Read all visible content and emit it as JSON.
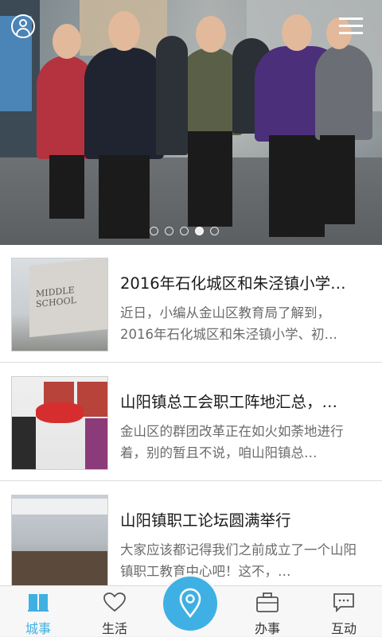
{
  "hero": {
    "slide_count": 5,
    "active_slide": 4
  },
  "news": [
    {
      "title": "2016年石化城区和朱泾镇小学…",
      "summary": "近日，小编从金山区教育局了解到，2016年石化城区和朱泾镇小学、初…",
      "thumb_icon": "school-gate-photo"
    },
    {
      "title": "山阳镇总工会职工阵地汇总，…",
      "summary": "金山区的群团改革正在如火如荼地进行着，别的暂且不说，咱山阳镇总…",
      "thumb_icon": "plaque-unveiling-photo"
    },
    {
      "title": "山阳镇职工论坛圆满举行",
      "summary": "大家应该都记得我们之前成立了一个山阳镇职工教育中心吧！这不，…",
      "thumb_icon": "meeting-room-photo"
    }
  ],
  "tabs": [
    {
      "label": "城事",
      "icon": "book-icon",
      "active": true
    },
    {
      "label": "生活",
      "icon": "heart-icon",
      "active": false
    },
    {
      "label": "",
      "icon": "location-pin-icon",
      "active": false
    },
    {
      "label": "办事",
      "icon": "briefcase-icon",
      "active": false
    },
    {
      "label": "互动",
      "icon": "chat-bubble-icon",
      "active": false
    }
  ],
  "colors": {
    "accent": "#3fb0e3",
    "text_primary": "#1a1a1a",
    "text_secondary": "#6b6b6b"
  }
}
